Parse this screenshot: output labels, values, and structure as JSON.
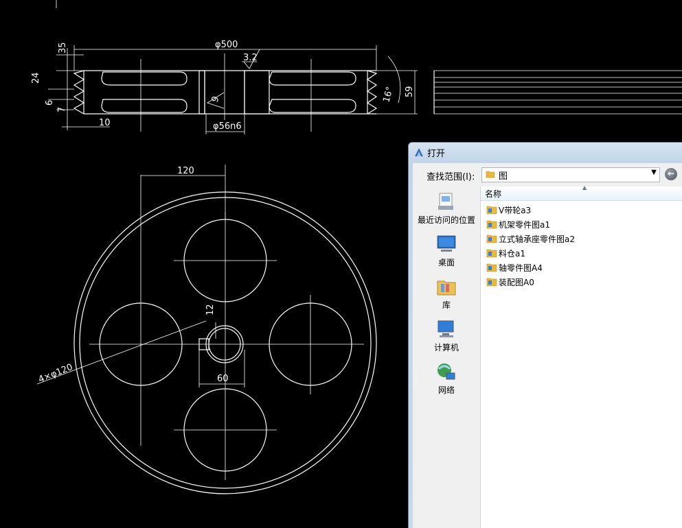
{
  "drawing": {
    "dims": {
      "d500": "φ500",
      "d35": "35",
      "d32": "3.2",
      "d24": "24",
      "d6": "6",
      "d7": "7",
      "d10": "10",
      "d9": "9",
      "d16": "16°",
      "d59": "59",
      "bore": "φ56n6",
      "d120": "120",
      "d12": "12",
      "d60": "60",
      "holes": "4×φ120"
    }
  },
  "dialog": {
    "title": "打开",
    "look_in_label": "查找范围(I):",
    "look_in_value": "图",
    "column_name": "名称",
    "places": [
      {
        "label": "最近访问的位置",
        "icon": "recent-places-icon"
      },
      {
        "label": "桌面",
        "icon": "desktop-icon"
      },
      {
        "label": "库",
        "icon": "libraries-icon"
      },
      {
        "label": "计算机",
        "icon": "computer-icon"
      },
      {
        "label": "网络",
        "icon": "network-icon"
      }
    ],
    "files": [
      {
        "name": "V带轮a3"
      },
      {
        "name": "机架零件图a1"
      },
      {
        "name": "立式轴承座零件图a2"
      },
      {
        "name": "料仓a1"
      },
      {
        "name": "轴零件图A4"
      },
      {
        "name": "装配图A0"
      }
    ]
  }
}
